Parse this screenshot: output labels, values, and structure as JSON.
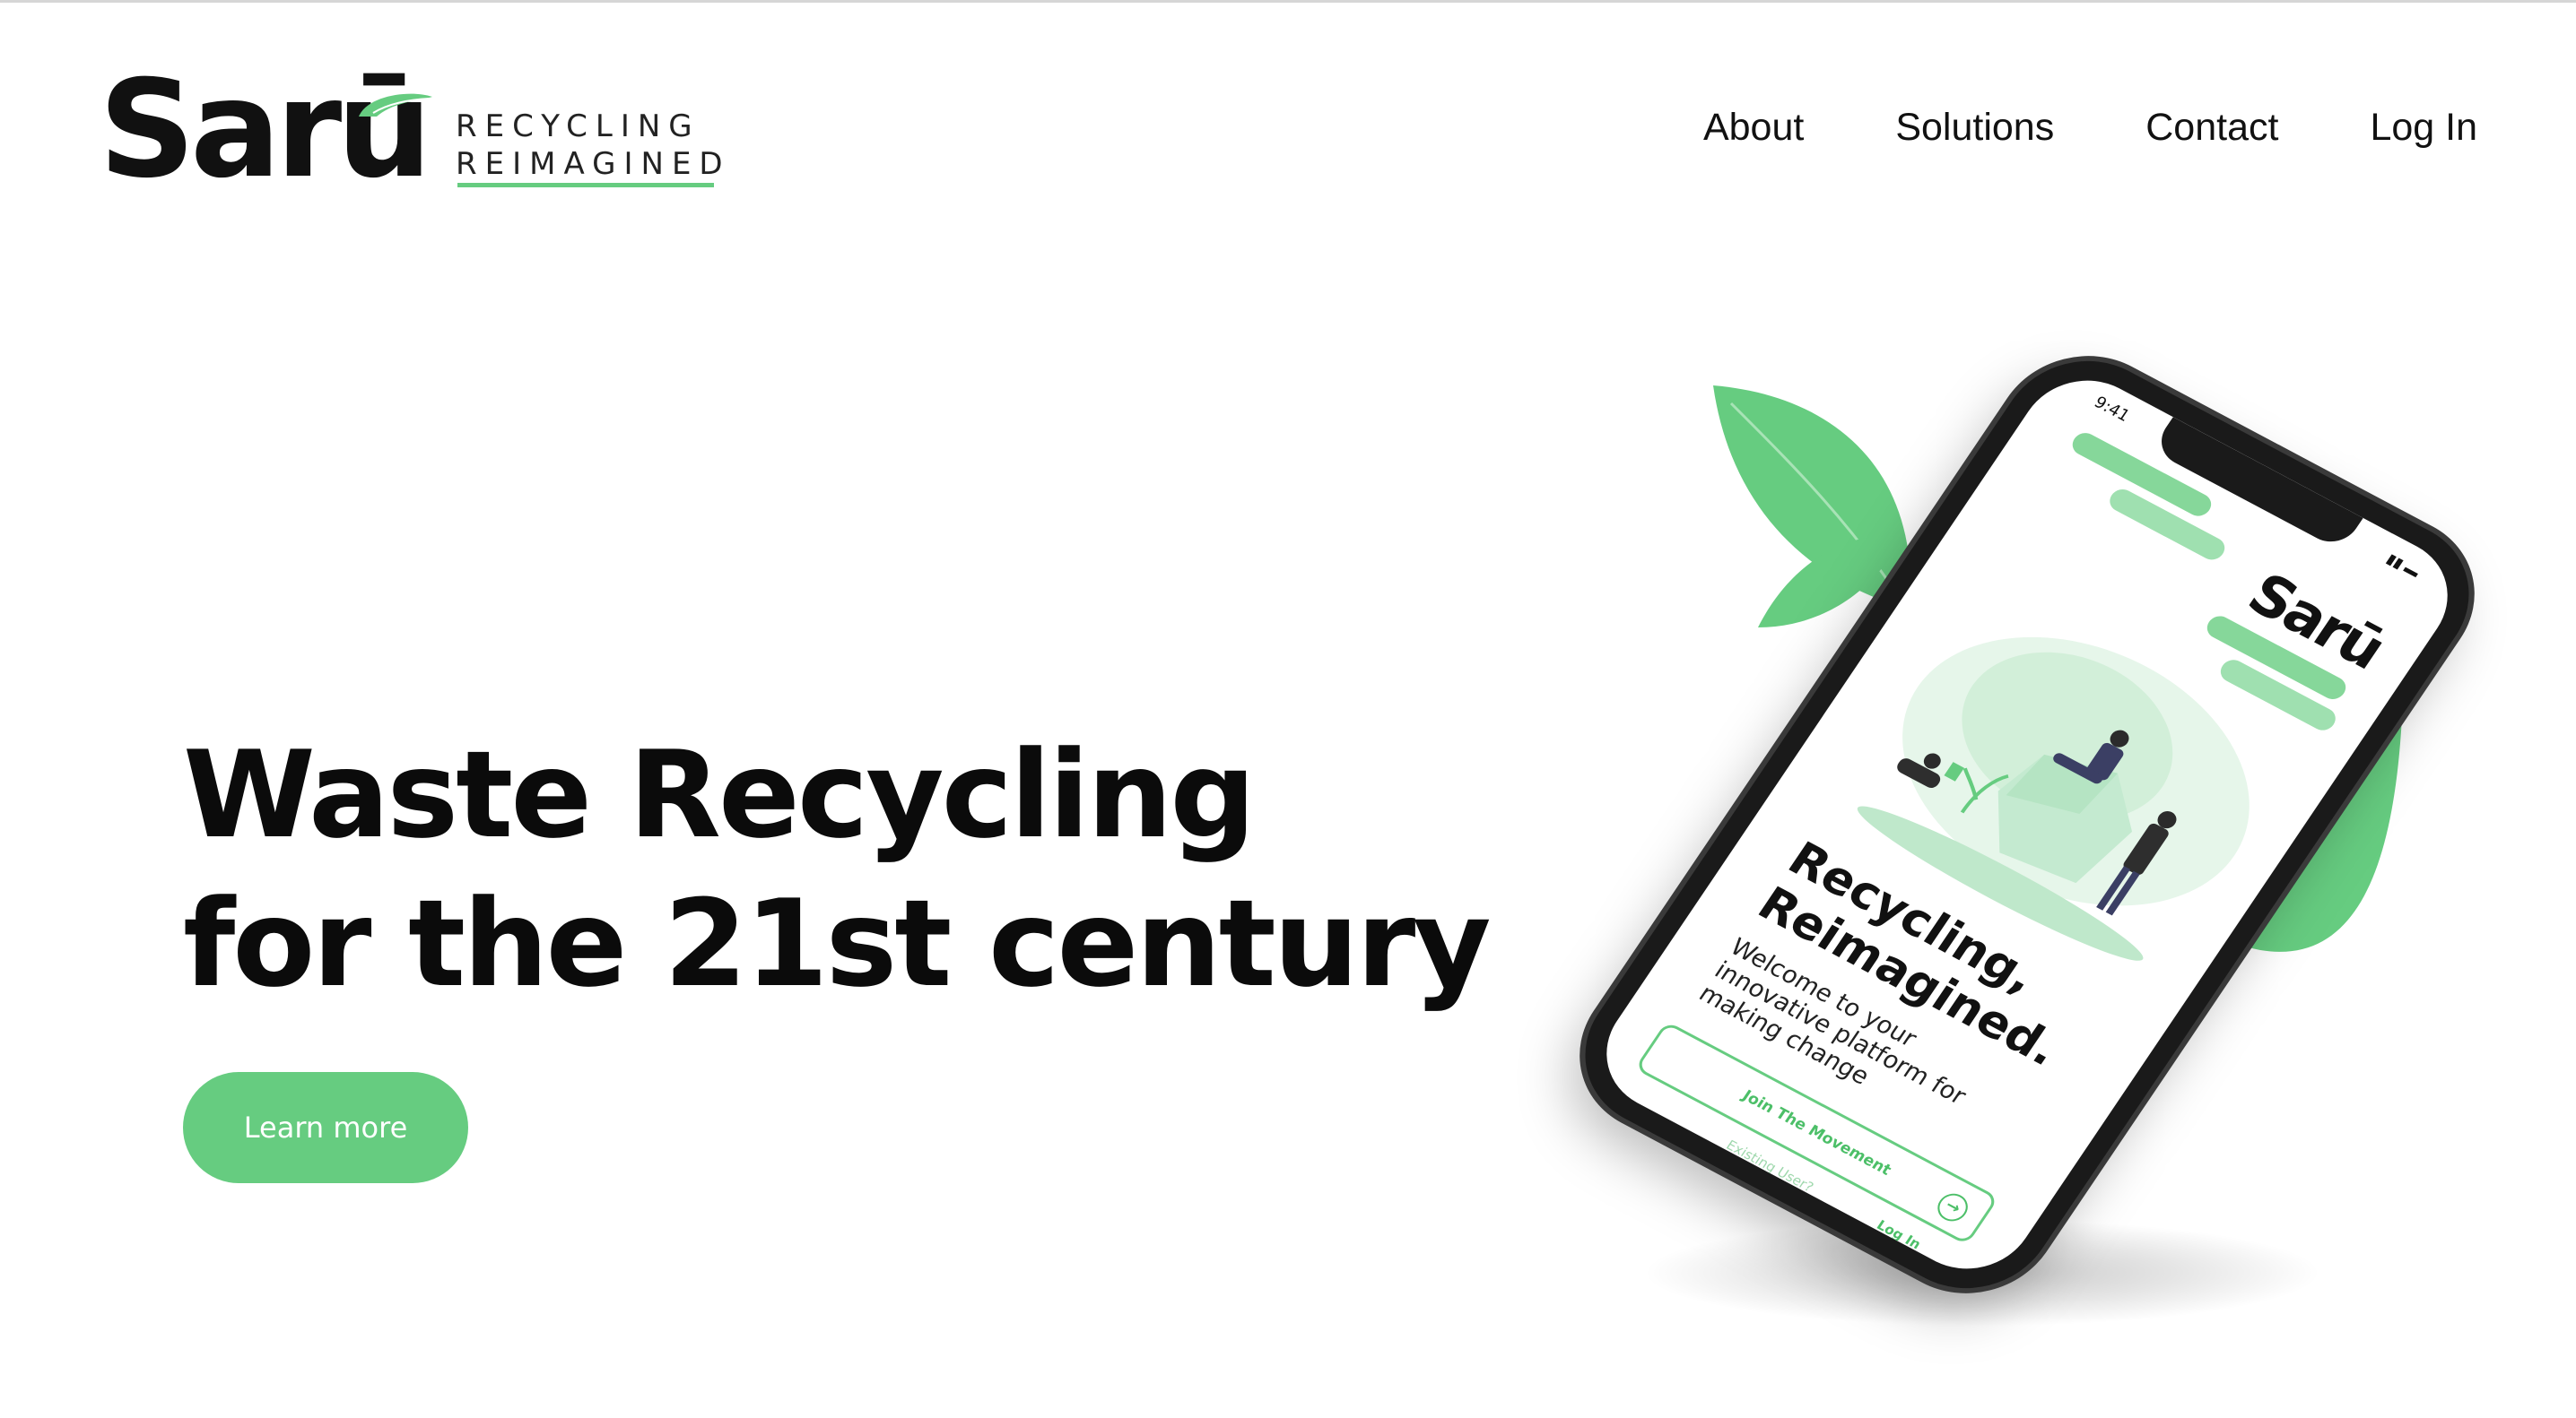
{
  "brand": {
    "name": "Sarū",
    "tagline_line1": "RECYCLING",
    "tagline_line2": "REIMAGINED",
    "accent_color": "#66cc80"
  },
  "nav": {
    "items": [
      {
        "label": "About"
      },
      {
        "label": "Solutions"
      },
      {
        "label": "Contact"
      },
      {
        "label": "Log In"
      }
    ]
  },
  "hero": {
    "title_line1": "Waste Recycling",
    "title_line2": "for the 21st century",
    "cta_label": "Learn more"
  },
  "phone_screen": {
    "status_time": "9:41",
    "logo": "Sarū",
    "title_line1": "Recycling,",
    "title_line2": "Reimagined.",
    "subtitle": "Welcome to your innovative platform for making change",
    "join_label": "Join The Movement",
    "existing_user_label": "Existing User?",
    "login_label": "Log In"
  },
  "icons": {
    "leaf": "leaf-icon",
    "arrow": "arrow-right-circle-icon"
  }
}
